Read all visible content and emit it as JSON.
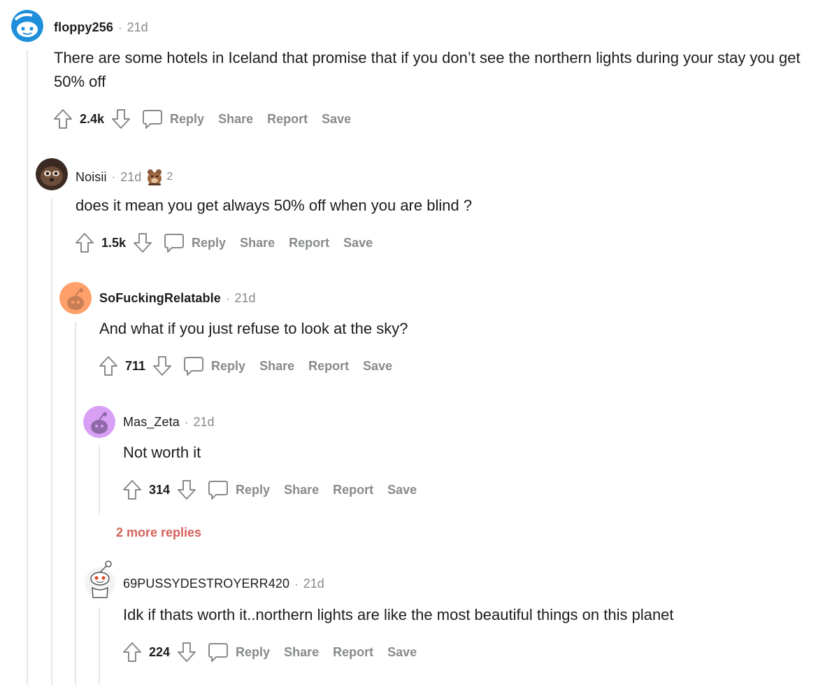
{
  "comments": [
    {
      "username": "floppy256",
      "time": "21d",
      "body": "There are some hotels in Iceland that promise that if you don’t see the northern lights during your stay you get 50% off",
      "score": "2.4k",
      "actions": {
        "reply": "Reply",
        "share": "Share",
        "report": "Report",
        "save": "Save"
      }
    },
    {
      "username": "Noisii",
      "time": "21d",
      "award_count": "2",
      "body": "does it mean you get always 50% off when you are blind ?",
      "score": "1.5k",
      "actions": {
        "reply": "Reply",
        "share": "Share",
        "report": "Report",
        "save": "Save"
      }
    },
    {
      "username": "SoFuckingRelatable",
      "time": "21d",
      "body": "And what if you just refuse to look at the sky?",
      "score": "711",
      "actions": {
        "reply": "Reply",
        "share": "Share",
        "report": "Report",
        "save": "Save"
      }
    },
    {
      "username": "Mas_Zeta",
      "time": "21d",
      "body": "Not worth it",
      "score": "314",
      "actions": {
        "reply": "Reply",
        "share": "Share",
        "report": "Report",
        "save": "Save"
      }
    },
    {
      "username": "69PUSSYDESTROYERR420",
      "time": "21d",
      "body": "Idk if thats worth it..northern lights are like the most beautiful things on this planet",
      "score": "224",
      "actions": {
        "reply": "Reply",
        "share": "Share",
        "report": "Report",
        "save": "Save"
      }
    }
  ],
  "more_replies": "2 more replies",
  "separator": "·",
  "colors": {
    "text": "#1c1c1c",
    "meta": "#878a8c",
    "thread_line": "#e5e7e9",
    "more_replies": "#d4625a"
  },
  "icons": [
    "upvote-icon",
    "downvote-icon",
    "comment-bubble-icon",
    "award-icon",
    "avatar-icon"
  ]
}
